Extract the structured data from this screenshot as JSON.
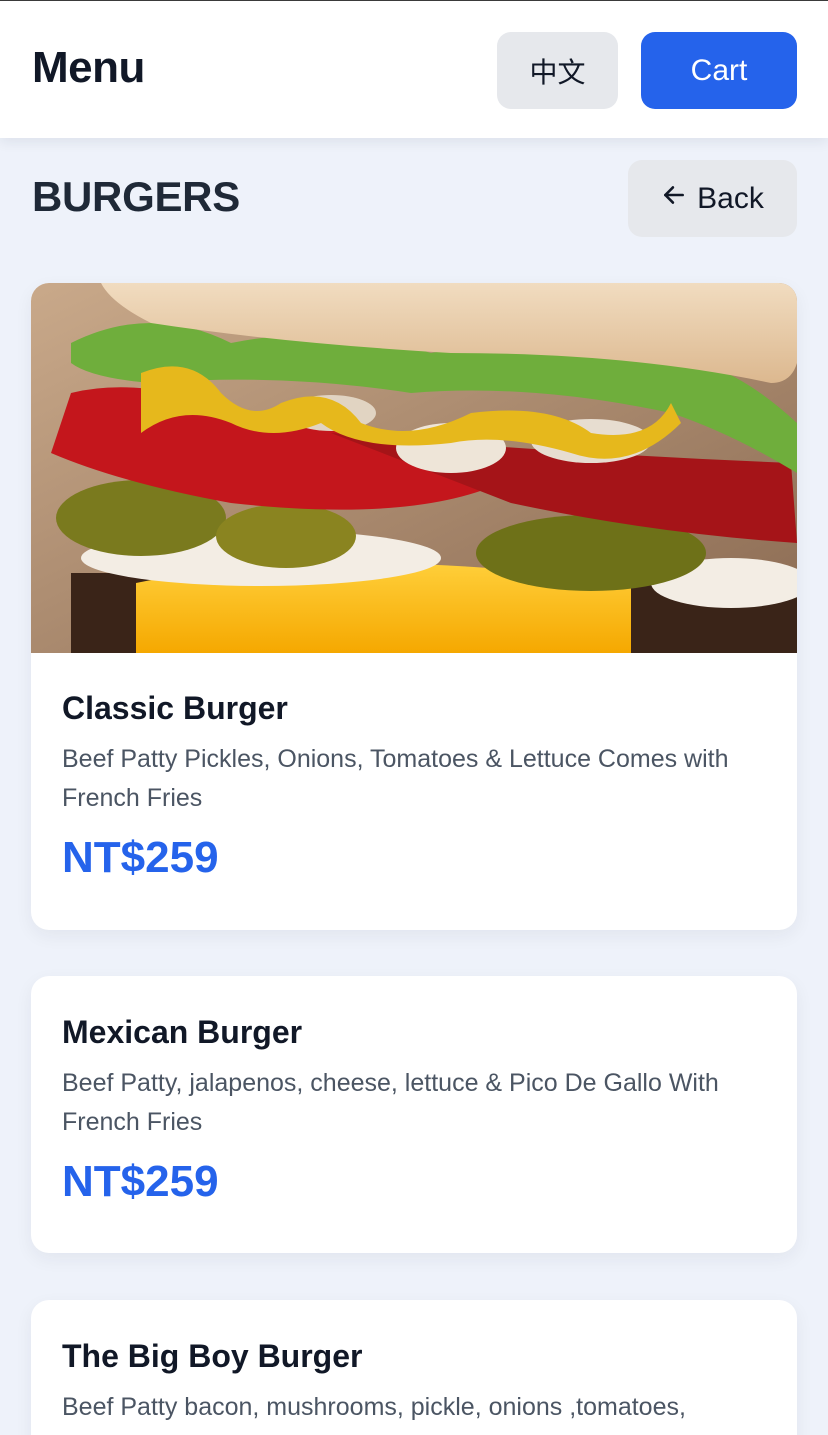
{
  "header": {
    "title": "Menu",
    "language_label": "中文",
    "cart_label": "Cart"
  },
  "section": {
    "title": "BURGERS",
    "back_label": "Back"
  },
  "items": [
    {
      "name": "Classic Burger",
      "description": "Beef Patty Pickles, Onions, Tomatoes & Lettuce Comes with French Fries",
      "price": "NT$259",
      "image": "burger-photo"
    },
    {
      "name": "Mexican Burger",
      "description": "Beef Patty, jalapenos, cheese, lettuce & Pico De Gallo With French Fries",
      "price": "NT$259"
    },
    {
      "name": "The Big Boy Burger",
      "description": "Beef Patty bacon, mushrooms, pickle, onions ,tomatoes,"
    }
  ],
  "colors": {
    "accent": "#2563eb",
    "background": "#eef2fa",
    "button_gray": "#e6e8ec"
  }
}
